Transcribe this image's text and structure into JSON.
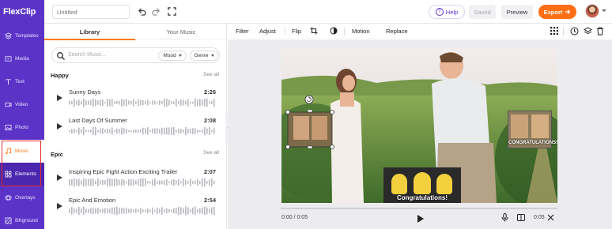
{
  "app": {
    "logo_text": "FlexClip"
  },
  "header": {
    "title_placeholder": "Untitled",
    "help_label": "Help",
    "saved_label": "Saved",
    "preview_label": "Preview",
    "export_label": "Export"
  },
  "nav": {
    "items": [
      {
        "label": "Templates",
        "icon": "templates-icon"
      },
      {
        "label": "Media",
        "icon": "media-icon"
      },
      {
        "label": "Text",
        "icon": "text-icon"
      },
      {
        "label": "Video",
        "icon": "video-icon"
      },
      {
        "label": "Photo",
        "icon": "photo-icon"
      },
      {
        "label": "Music",
        "icon": "music-icon"
      },
      {
        "label": "Elements",
        "icon": "elements-icon"
      },
      {
        "label": "Overlays",
        "icon": "overlays-icon"
      },
      {
        "label": "BKground",
        "icon": "background-icon"
      }
    ]
  },
  "library": {
    "tabs": [
      "Library",
      "Your Music"
    ],
    "search_placeholder": "Search Music...",
    "mood_label": "Mood",
    "genre_label": "Genre",
    "sections": [
      {
        "title": "Happy",
        "see_all": "See all",
        "tracks": [
          {
            "name": "Sunny Days",
            "duration": "2:26"
          },
          {
            "name": "Last Days Of Summer",
            "duration": "2:08"
          }
        ]
      },
      {
        "title": "Epic",
        "see_all": "See all",
        "tracks": [
          {
            "name": "Inspiring Epic Fight Action Exciting Trailer",
            "duration": "2:07"
          },
          {
            "name": "Epic And Emotion",
            "duration": "2:54"
          }
        ]
      }
    ]
  },
  "toolbar": {
    "filter": "Filter",
    "adjust": "Adjust",
    "flip": "Flip",
    "motion": "Motion",
    "replace": "Replace"
  },
  "player": {
    "current_time": "0:00 / 0:05",
    "end_time": "0:05",
    "progress": 0.0
  },
  "stickers": {
    "right_caption": "CONGRATULATIONS!",
    "bottom_caption": "Congratulations!"
  },
  "colors": {
    "brand": "#5b33c7",
    "accent": "#ff6e14",
    "active_nav": "#ff7a1a",
    "highlight_box": "#e32d2d"
  }
}
